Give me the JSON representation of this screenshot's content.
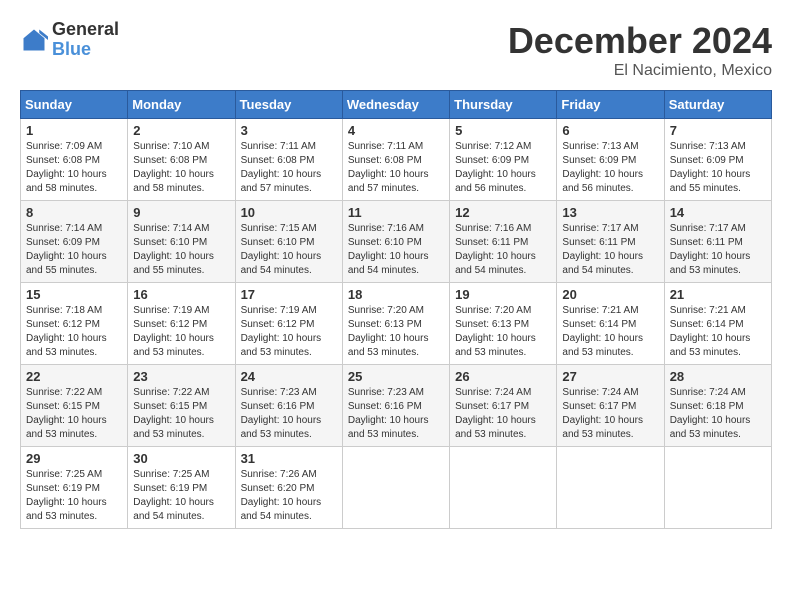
{
  "logo": {
    "general": "General",
    "blue": "Blue"
  },
  "title": "December 2024",
  "subtitle": "El Nacimiento, Mexico",
  "weekdays": [
    "Sunday",
    "Monday",
    "Tuesday",
    "Wednesday",
    "Thursday",
    "Friday",
    "Saturday"
  ],
  "weeks": [
    [
      {
        "day": "1",
        "info": "Sunrise: 7:09 AM\nSunset: 6:08 PM\nDaylight: 10 hours\nand 58 minutes."
      },
      {
        "day": "2",
        "info": "Sunrise: 7:10 AM\nSunset: 6:08 PM\nDaylight: 10 hours\nand 58 minutes."
      },
      {
        "day": "3",
        "info": "Sunrise: 7:11 AM\nSunset: 6:08 PM\nDaylight: 10 hours\nand 57 minutes."
      },
      {
        "day": "4",
        "info": "Sunrise: 7:11 AM\nSunset: 6:08 PM\nDaylight: 10 hours\nand 57 minutes."
      },
      {
        "day": "5",
        "info": "Sunrise: 7:12 AM\nSunset: 6:09 PM\nDaylight: 10 hours\nand 56 minutes."
      },
      {
        "day": "6",
        "info": "Sunrise: 7:13 AM\nSunset: 6:09 PM\nDaylight: 10 hours\nand 56 minutes."
      },
      {
        "day": "7",
        "info": "Sunrise: 7:13 AM\nSunset: 6:09 PM\nDaylight: 10 hours\nand 55 minutes."
      }
    ],
    [
      {
        "day": "8",
        "info": "Sunrise: 7:14 AM\nSunset: 6:09 PM\nDaylight: 10 hours\nand 55 minutes."
      },
      {
        "day": "9",
        "info": "Sunrise: 7:14 AM\nSunset: 6:10 PM\nDaylight: 10 hours\nand 55 minutes."
      },
      {
        "day": "10",
        "info": "Sunrise: 7:15 AM\nSunset: 6:10 PM\nDaylight: 10 hours\nand 54 minutes."
      },
      {
        "day": "11",
        "info": "Sunrise: 7:16 AM\nSunset: 6:10 PM\nDaylight: 10 hours\nand 54 minutes."
      },
      {
        "day": "12",
        "info": "Sunrise: 7:16 AM\nSunset: 6:11 PM\nDaylight: 10 hours\nand 54 minutes."
      },
      {
        "day": "13",
        "info": "Sunrise: 7:17 AM\nSunset: 6:11 PM\nDaylight: 10 hours\nand 54 minutes."
      },
      {
        "day": "14",
        "info": "Sunrise: 7:17 AM\nSunset: 6:11 PM\nDaylight: 10 hours\nand 53 minutes."
      }
    ],
    [
      {
        "day": "15",
        "info": "Sunrise: 7:18 AM\nSunset: 6:12 PM\nDaylight: 10 hours\nand 53 minutes."
      },
      {
        "day": "16",
        "info": "Sunrise: 7:19 AM\nSunset: 6:12 PM\nDaylight: 10 hours\nand 53 minutes."
      },
      {
        "day": "17",
        "info": "Sunrise: 7:19 AM\nSunset: 6:12 PM\nDaylight: 10 hours\nand 53 minutes."
      },
      {
        "day": "18",
        "info": "Sunrise: 7:20 AM\nSunset: 6:13 PM\nDaylight: 10 hours\nand 53 minutes."
      },
      {
        "day": "19",
        "info": "Sunrise: 7:20 AM\nSunset: 6:13 PM\nDaylight: 10 hours\nand 53 minutes."
      },
      {
        "day": "20",
        "info": "Sunrise: 7:21 AM\nSunset: 6:14 PM\nDaylight: 10 hours\nand 53 minutes."
      },
      {
        "day": "21",
        "info": "Sunrise: 7:21 AM\nSunset: 6:14 PM\nDaylight: 10 hours\nand 53 minutes."
      }
    ],
    [
      {
        "day": "22",
        "info": "Sunrise: 7:22 AM\nSunset: 6:15 PM\nDaylight: 10 hours\nand 53 minutes."
      },
      {
        "day": "23",
        "info": "Sunrise: 7:22 AM\nSunset: 6:15 PM\nDaylight: 10 hours\nand 53 minutes."
      },
      {
        "day": "24",
        "info": "Sunrise: 7:23 AM\nSunset: 6:16 PM\nDaylight: 10 hours\nand 53 minutes."
      },
      {
        "day": "25",
        "info": "Sunrise: 7:23 AM\nSunset: 6:16 PM\nDaylight: 10 hours\nand 53 minutes."
      },
      {
        "day": "26",
        "info": "Sunrise: 7:24 AM\nSunset: 6:17 PM\nDaylight: 10 hours\nand 53 minutes."
      },
      {
        "day": "27",
        "info": "Sunrise: 7:24 AM\nSunset: 6:17 PM\nDaylight: 10 hours\nand 53 minutes."
      },
      {
        "day": "28",
        "info": "Sunrise: 7:24 AM\nSunset: 6:18 PM\nDaylight: 10 hours\nand 53 minutes."
      }
    ],
    [
      {
        "day": "29",
        "info": "Sunrise: 7:25 AM\nSunset: 6:19 PM\nDaylight: 10 hours\nand 53 minutes."
      },
      {
        "day": "30",
        "info": "Sunrise: 7:25 AM\nSunset: 6:19 PM\nDaylight: 10 hours\nand 54 minutes."
      },
      {
        "day": "31",
        "info": "Sunrise: 7:26 AM\nSunset: 6:20 PM\nDaylight: 10 hours\nand 54 minutes."
      },
      {
        "day": "",
        "info": ""
      },
      {
        "day": "",
        "info": ""
      },
      {
        "day": "",
        "info": ""
      },
      {
        "day": "",
        "info": ""
      }
    ]
  ]
}
